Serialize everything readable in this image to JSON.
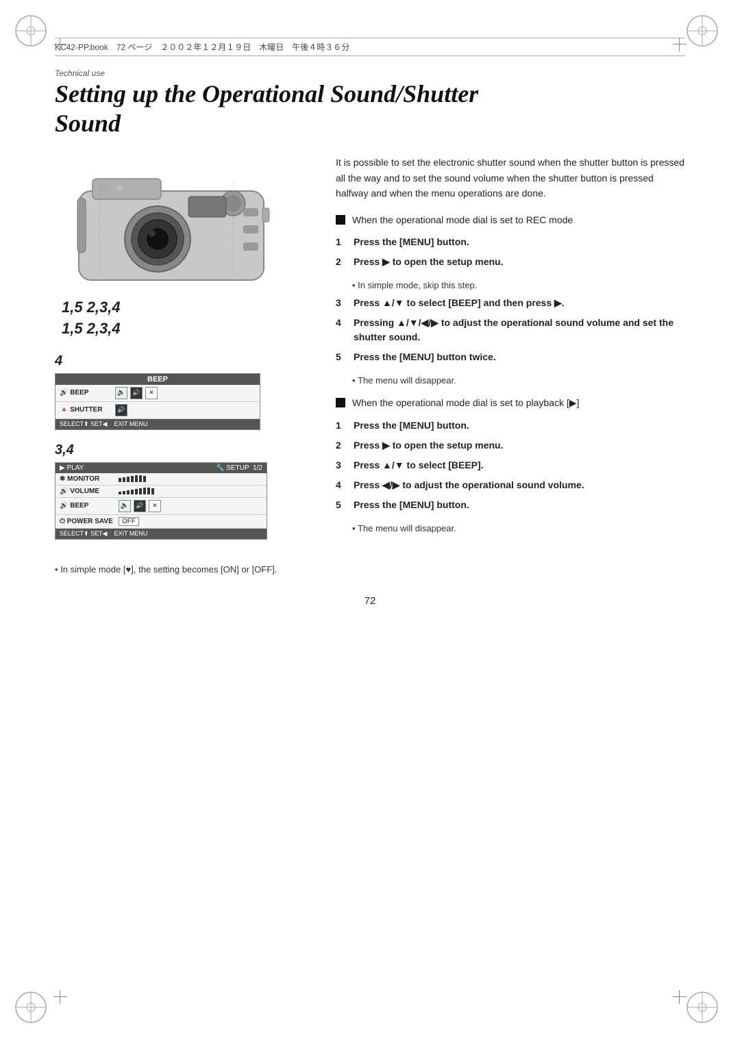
{
  "header": {
    "text": "KC42-PP.book　72 ページ　２００２年１２月１９日　木曜日　午後４時３６分"
  },
  "page": {
    "technical_use": "Technical use",
    "title_line1": "Setting up the Operational Sound/Shutter",
    "title_line2": "Sound"
  },
  "intro": "It is possible to set the electronic shutter sound when the shutter button is pressed all the way and to set the sound volume when the shutter button is pressed halfway and when the menu operations are done.",
  "camera_labels": {
    "line1": "1,5  2,3,4",
    "line2": "1,5  2,3,4"
  },
  "menu4_label": "4",
  "menu34_label": "3,4",
  "section1": {
    "title": "When the operational mode dial is set to REC mode",
    "steps": [
      {
        "num": "1",
        "text": "Press the [MENU] button."
      },
      {
        "num": "2",
        "text": "Press ▶ to open the setup menu."
      },
      {
        "bullet": "In simple mode, skip this step."
      },
      {
        "num": "3",
        "text": "Press ▲/▼ to select [BEEP] and then press ▶."
      },
      {
        "num": "4",
        "text": "Pressing ▲/▼/◀/▶ to adjust the operational sound volume and set the shutter sound."
      },
      {
        "num": "5",
        "text": "Press the [MENU] button twice."
      },
      {
        "bullet": "The menu will disappear."
      }
    ]
  },
  "section2": {
    "title": "When the operational mode dial is set to playback [▶]",
    "steps": [
      {
        "num": "1",
        "text": "Press the [MENU] button."
      },
      {
        "num": "2",
        "text": "Press ▶ to open the setup menu."
      },
      {
        "num": "3",
        "text": "Press ▲/▼ to select [BEEP]."
      },
      {
        "num": "4",
        "text": "Press ◀/▶ to adjust the operational sound volume."
      },
      {
        "num": "5",
        "text": "Press the [MENU] button."
      },
      {
        "bullet": "The menu will disappear."
      }
    ]
  },
  "bottom_note": "In simple mode [♥], the setting becomes [ON] or [OFF].",
  "page_number": "72",
  "menu_box1": {
    "title": "BEEP",
    "rows": [
      {
        "label": "🔊 BEEP",
        "icons": [
          "🔈",
          "🔊",
          "🔇"
        ]
      },
      {
        "label": "🔺 SHUTTER",
        "icons": [
          "🔊"
        ]
      }
    ],
    "footer": [
      "SELECT⬆ SET◀",
      "EXIT MENU"
    ]
  },
  "menu_box2": {
    "header_left": "▶ PLAY",
    "header_right": "🔧 SETUP  1/2",
    "rows": [
      {
        "label": "❄ MONITOR",
        "value": "bars"
      },
      {
        "label": "🔊 VOLUME",
        "value": "vol_bars"
      },
      {
        "label": "🔊 BEEP",
        "icons": true
      },
      {
        "label": "⏻ POWER SAVE",
        "value": "OFF"
      }
    ],
    "footer": [
      "SELECT⬆ SET◀",
      "EXIT MENU"
    ]
  }
}
